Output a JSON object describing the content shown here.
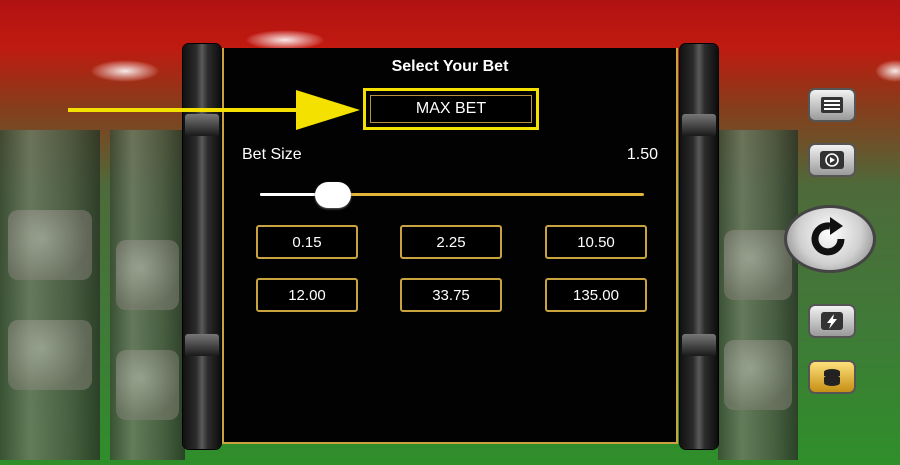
{
  "dialog": {
    "title": "Select Your Bet",
    "max_bet_label": "MAX BET",
    "bet_size_label": "Bet Size",
    "bet_size_value": "1.50"
  },
  "slider": {
    "level_fraction": 0.19
  },
  "bet_options": [
    "0.15",
    "2.25",
    "10.50",
    "12.00",
    "33.75",
    "135.00"
  ],
  "side_buttons": {
    "menu_icon": "menu-icon",
    "autoplay_icon": "autoplay-icon",
    "spin_icon": "spin-icon",
    "turbo_icon": "lightning-icon",
    "bet_icon": "coin-stack-icon"
  },
  "colors": {
    "highlight": "#f4e100",
    "gold_border": "#c9a43e",
    "panel_bg": "#020202"
  }
}
